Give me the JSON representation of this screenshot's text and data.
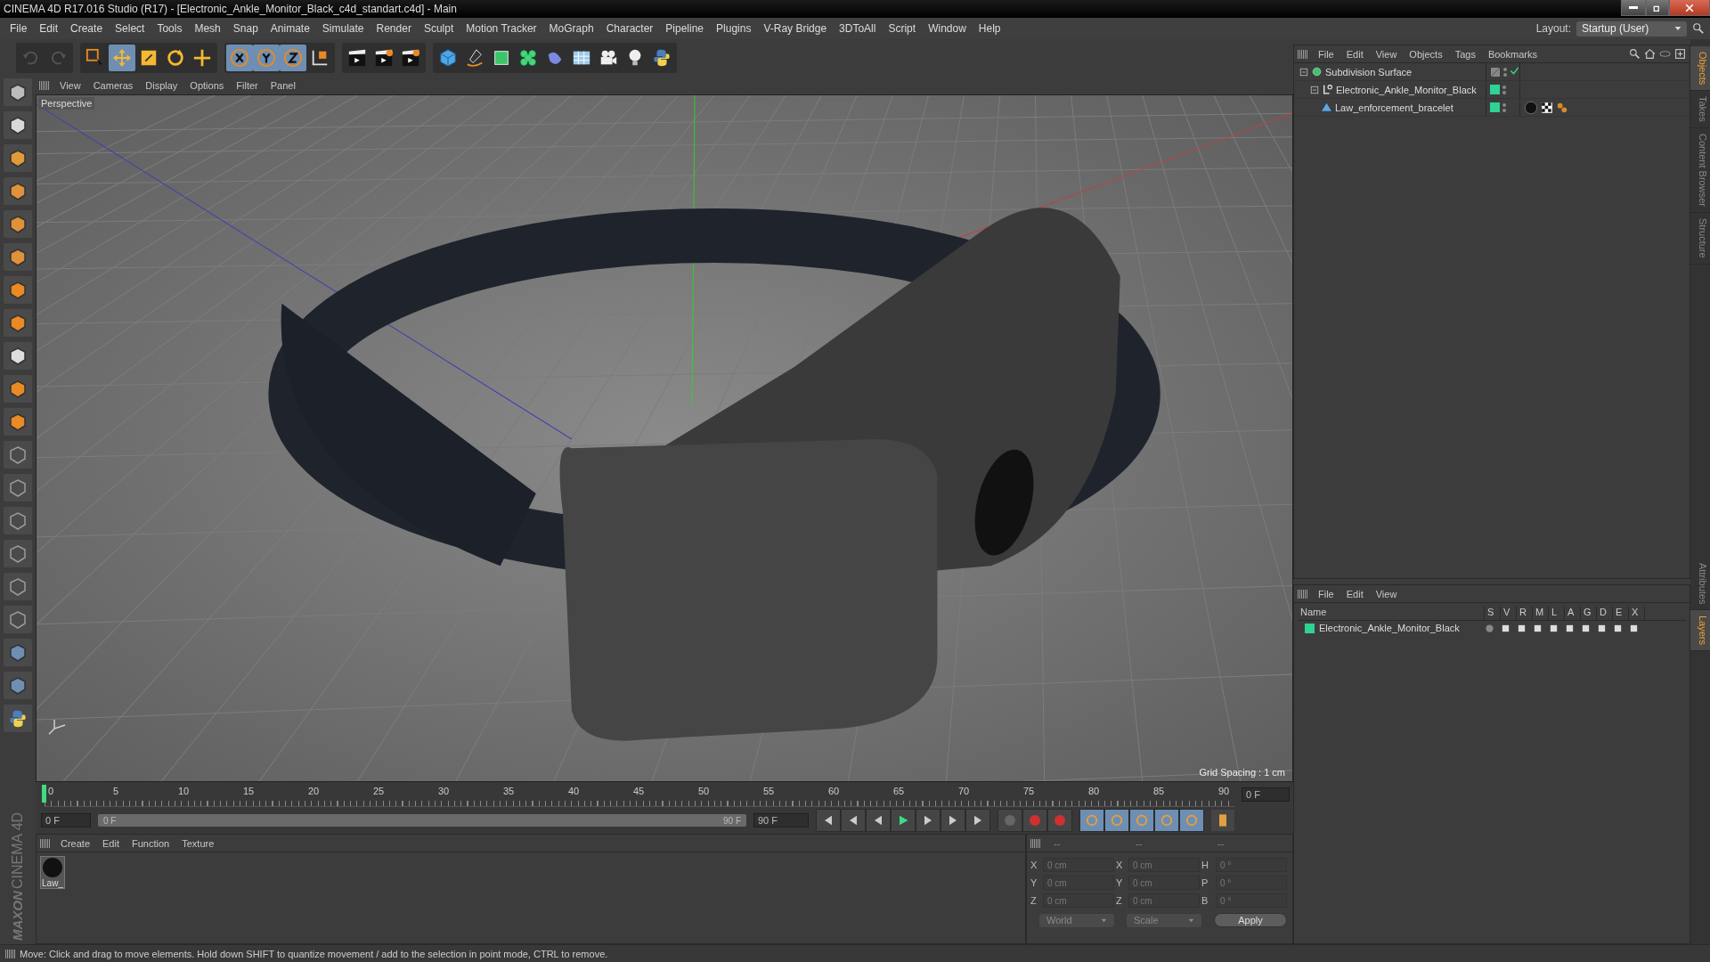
{
  "window": {
    "title": "CINEMA 4D R17.016 Studio (R17) - [Electronic_Ankle_Monitor_Black_c4d_standart.c4d] - Main"
  },
  "menu": [
    "File",
    "Edit",
    "Create",
    "Select",
    "Tools",
    "Mesh",
    "Snap",
    "Animate",
    "Simulate",
    "Render",
    "Sculpt",
    "Motion Tracker",
    "MoGraph",
    "Character",
    "Pipeline",
    "Plugins",
    "V-Ray Bridge",
    "3DToAll",
    "Script",
    "Window",
    "Help"
  ],
  "layout": {
    "label": "Layout:",
    "value": "Startup (User)"
  },
  "toolbar": [
    {
      "kind": "undo",
      "selected": false,
      "disabled": true
    },
    {
      "kind": "redo",
      "selected": false,
      "disabled": true
    },
    {
      "kind": "select",
      "selected": false,
      "disabled": false
    },
    {
      "kind": "move",
      "selected": true,
      "disabled": false
    },
    {
      "kind": "scale",
      "selected": false,
      "disabled": false
    },
    {
      "kind": "rotate",
      "selected": false,
      "disabled": false
    },
    {
      "kind": "transform",
      "selected": false,
      "disabled": false
    },
    {
      "kind": "axis-x",
      "selected": true,
      "disabled": false
    },
    {
      "kind": "axis-y",
      "selected": true,
      "disabled": false
    },
    {
      "kind": "axis-z",
      "selected": true,
      "disabled": false
    },
    {
      "kind": "coords",
      "selected": false,
      "disabled": false
    },
    {
      "kind": "render-view",
      "selected": false,
      "disabled": false
    },
    {
      "kind": "render-picture",
      "selected": false,
      "disabled": false
    },
    {
      "kind": "render-settings",
      "selected": false,
      "disabled": false
    },
    {
      "kind": "cube",
      "selected": false,
      "disabled": false
    },
    {
      "kind": "pen",
      "selected": false,
      "disabled": false
    },
    {
      "kind": "subdivision",
      "selected": false,
      "disabled": false
    },
    {
      "kind": "cloner",
      "selected": false,
      "disabled": false
    },
    {
      "kind": "deformer",
      "selected": false,
      "disabled": false
    },
    {
      "kind": "floor",
      "selected": false,
      "disabled": false
    },
    {
      "kind": "camera",
      "selected": false,
      "disabled": false
    },
    {
      "kind": "light",
      "selected": false,
      "disabled": false
    },
    {
      "kind": "python",
      "selected": false,
      "disabled": false
    }
  ],
  "viewport": {
    "menu": [
      "View",
      "Cameras",
      "Display",
      "Options",
      "Filter",
      "Panel"
    ],
    "camera": "Perspective",
    "grid_spacing": "Grid Spacing : 1 cm"
  },
  "timeline": {
    "ticks": [
      "0",
      "5",
      "10",
      "15",
      "20",
      "25",
      "30",
      "35",
      "40",
      "45",
      "50",
      "55",
      "60",
      "65",
      "70",
      "75",
      "80",
      "85",
      "90"
    ],
    "current": "0 F",
    "start": "0 F",
    "range": {
      "start": "0 F",
      "end": "90 F",
      "level": 1
    },
    "end": "90 F"
  },
  "material_manager": {
    "menu": [
      "Create",
      "Edit",
      "Function",
      "Texture"
    ],
    "materials": [
      {
        "name": "Law_"
      }
    ]
  },
  "coordinates": {
    "headers": [
      "--",
      "--",
      "--"
    ],
    "rows": [
      {
        "axis": "X",
        "position": "0 cm",
        "size_axis": "X",
        "size": "0 cm",
        "rot_axis": "H",
        "rotation": "0 °"
      },
      {
        "axis": "Y",
        "position": "0 cm",
        "size_axis": "Y",
        "size": "0 cm",
        "rot_axis": "P",
        "rotation": "0 °"
      },
      {
        "axis": "Z",
        "position": "0 cm",
        "size_axis": "Z",
        "size": "0 cm",
        "rot_axis": "B",
        "rotation": "0 °"
      }
    ],
    "space": "World",
    "mode": "Scale",
    "apply": "Apply"
  },
  "logo": {
    "brand": "MAXON",
    "product": "CINEMA 4D"
  },
  "object_manager": {
    "menu": [
      "File",
      "Edit",
      "View",
      "Objects",
      "Tags",
      "Bookmarks"
    ],
    "objects": [
      {
        "name": "Subdivision Surface",
        "kind": "subdivision",
        "enabled": true,
        "children": [
          {
            "name": "Electronic_Ankle_Monitor_Black",
            "kind": "null",
            "color": "#2ed394",
            "children": [
              {
                "name": "Law_enforcement_bracelet",
                "kind": "polygon",
                "color": "#2ed394",
                "tags": [
                  {
                    "kind": "material"
                  },
                  {
                    "kind": "texture"
                  },
                  {
                    "kind": "phong"
                  }
                ]
              }
            ]
          }
        ]
      }
    ]
  },
  "layer_manager": {
    "menu": [
      "File",
      "Edit",
      "View"
    ],
    "columns": [
      "Name",
      "S",
      "V",
      "R",
      "M",
      "L",
      "A",
      "G",
      "D",
      "E",
      "X"
    ],
    "layers": [
      {
        "name": "Electronic_Ankle_Monitor_Black",
        "color": "#2ed394"
      }
    ]
  },
  "side_tabs_top": [
    {
      "label": "Objects",
      "selected": true
    },
    {
      "label": "Takes",
      "selected": false
    },
    {
      "label": "Content Browser",
      "selected": false
    },
    {
      "label": "Structure",
      "selected": false
    }
  ],
  "side_tabs_bottom": [
    {
      "label": "Attributes",
      "selected": false
    },
    {
      "label": "Layers",
      "selected": true
    }
  ],
  "status_bar": "Move: Click and drag to move elements. Hold down SHIFT to quantize movement / add to the selection in point mode, CTRL to remove."
}
